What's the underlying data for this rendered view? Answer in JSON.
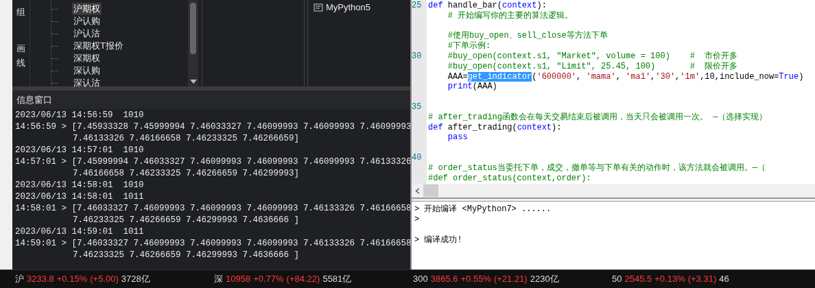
{
  "side_tabs": [
    {
      "label": "组",
      "selected": false
    },
    {
      "label": "画线",
      "selected": false
    }
  ],
  "tree": {
    "items": [
      {
        "label": "沪期权",
        "selected": true
      },
      {
        "label": "沪认购",
        "selected": false
      },
      {
        "label": "沪认沽",
        "selected": false
      },
      {
        "label": "深期权T报价",
        "selected": false
      },
      {
        "label": "深期权",
        "selected": false
      },
      {
        "label": "深认购",
        "selected": false
      },
      {
        "label": "深认沽",
        "selected": false
      }
    ]
  },
  "file_panel": {
    "items": [
      {
        "label": "MyPython5"
      }
    ]
  },
  "info_window": {
    "title": "信息窗口",
    "lines": [
      {
        "kind": "head",
        "text": "2023/06/13 14:56:59  1010"
      },
      {
        "kind": "head",
        "text": "14:56:59 > [7.45933328 7.45999994 7.46033327 7.46099993 7.46099993 7.46099993"
      },
      {
        "kind": "cont",
        "text": "7.46133326 7.46166658 7.46233325 7.46266659]"
      },
      {
        "kind": "head",
        "text": "2023/06/13 14:57:01  1010"
      },
      {
        "kind": "head",
        "text": "14:57:01 > [7.45999994 7.46033327 7.46099993 7.46099993 7.46099993 7.46133326"
      },
      {
        "kind": "cont",
        "text": "7.46166658 7.46233325 7.46266659 7.46299993]"
      },
      {
        "kind": "head",
        "text": "2023/06/13 14:58:01  1010"
      },
      {
        "kind": "head",
        "text": "2023/06/13 14:58:01  1011"
      },
      {
        "kind": "head",
        "text": "14:58:01 > [7.46033327 7.46099993 7.46099993 7.46099993 7.46133326 7.46166658"
      },
      {
        "kind": "cont",
        "text": "7.46233325 7.46266659 7.46299993 7.4636666 ]"
      },
      {
        "kind": "head",
        "text": "2023/06/13 14:59:01  1011"
      },
      {
        "kind": "head",
        "text": "14:59:01 > [7.46033327 7.46099993 7.46099993 7.46099993 7.46133326 7.46166658"
      },
      {
        "kind": "cont",
        "text": "7.46233325 7.46266659 7.46299993 7.4636666 ]"
      }
    ]
  },
  "editor": {
    "lines": [
      {
        "number": "25",
        "tokens": [
          {
            "kind": "kw",
            "text": "def"
          },
          {
            "kind": "plain",
            "text": " handle_bar("
          },
          {
            "kind": "kw",
            "text": "context"
          },
          {
            "kind": "plain",
            "text": "):"
          }
        ]
      },
      {
        "tokens": [
          {
            "kind": "comment",
            "text": "    # 开始编写你的主要的算法逻辑。"
          }
        ]
      },
      {
        "kind": "blank"
      },
      {
        "tokens": [
          {
            "kind": "comment",
            "text": "    #使用buy_open、sell_close等方法下单"
          }
        ]
      },
      {
        "tokens": [
          {
            "kind": "comment",
            "text": "    #下单示例:"
          }
        ]
      },
      {
        "number": "30",
        "tokens": [
          {
            "kind": "comment",
            "text": "    #buy_open(context.s1, \"Market\", volume = 100)    #  市价开多"
          }
        ]
      },
      {
        "tokens": [
          {
            "kind": "comment",
            "text": "    #buy_open(context.s1, \"Limit\", 25.45, 100)       #  限价开多"
          }
        ]
      },
      {
        "tokens": [
          {
            "kind": "plain",
            "text": "    AAA="
          },
          {
            "kind": "sel",
            "text": "get_indicator"
          },
          {
            "kind": "plain",
            "text": "("
          },
          {
            "kind": "str",
            "text": "'600000'"
          },
          {
            "kind": "plain",
            "text": ", "
          },
          {
            "kind": "str",
            "text": "'mama'"
          },
          {
            "kind": "plain",
            "text": ", "
          },
          {
            "kind": "str",
            "text": "'ma1'"
          },
          {
            "kind": "plain",
            "text": ","
          },
          {
            "kind": "str",
            "text": "'30'"
          },
          {
            "kind": "plain",
            "text": ","
          },
          {
            "kind": "str",
            "text": "'1m'"
          },
          {
            "kind": "plain",
            "text": ",10,include_now="
          },
          {
            "kind": "kw",
            "text": "True"
          },
          {
            "kind": "plain",
            "text": ")"
          }
        ]
      },
      {
        "tokens": [
          {
            "kind": "kw",
            "text": "    print"
          },
          {
            "kind": "plain",
            "text": "(AAA)"
          }
        ]
      },
      {
        "kind": "blank"
      },
      {
        "kind": "blank",
        "number": "35"
      },
      {
        "tokens": [
          {
            "kind": "comment",
            "text": "# after_trading函数会在每天交易结束后被调用，当天只会被调用一次。 —（选择实现）"
          }
        ]
      },
      {
        "tokens": [
          {
            "kind": "kw",
            "text": "def"
          },
          {
            "kind": "plain",
            "text": " after_trading("
          },
          {
            "kind": "kw",
            "text": "context"
          },
          {
            "kind": "plain",
            "text": "):"
          }
        ]
      },
      {
        "tokens": [
          {
            "kind": "kw",
            "text": "    pass"
          }
        ]
      },
      {
        "kind": "blank"
      },
      {
        "kind": "blank",
        "number": "40"
      },
      {
        "tokens": [
          {
            "kind": "comment",
            "text": "# order_status当委托下单，成交，撤单等与下单有关的动作时，该方法就会被调用。—（"
          }
        ]
      },
      {
        "tokens": [
          {
            "kind": "comment",
            "text": "#def order_status(context,order):"
          }
        ]
      }
    ]
  },
  "output": {
    "lines": [
      {
        "kind": "text",
        "text": "> 开始编译 <MyPython7> ......"
      },
      {
        "kind": "text",
        "text": ">"
      },
      {
        "kind": "blank"
      },
      {
        "kind": "text",
        "text": "> 编译成功!"
      }
    ]
  },
  "status_bar": {
    "indices": [
      {
        "label": "沪",
        "value": "3233.8",
        "change": "+0.15%",
        "delta": "(+5.00)",
        "amount": "3728亿"
      },
      {
        "label": "深",
        "value": "10958",
        "change": "+0.77%",
        "delta": "(+84.22)",
        "amount": "5581亿"
      },
      {
        "label": "300",
        "value": "3865.6",
        "change": "+0.55%",
        "delta": "(+21.21)",
        "amount": "2230亿"
      },
      {
        "label": "50",
        "value": "2545.5",
        "change": "+0.13%",
        "delta": "(+3.31)",
        "amount": "46"
      }
    ]
  }
}
